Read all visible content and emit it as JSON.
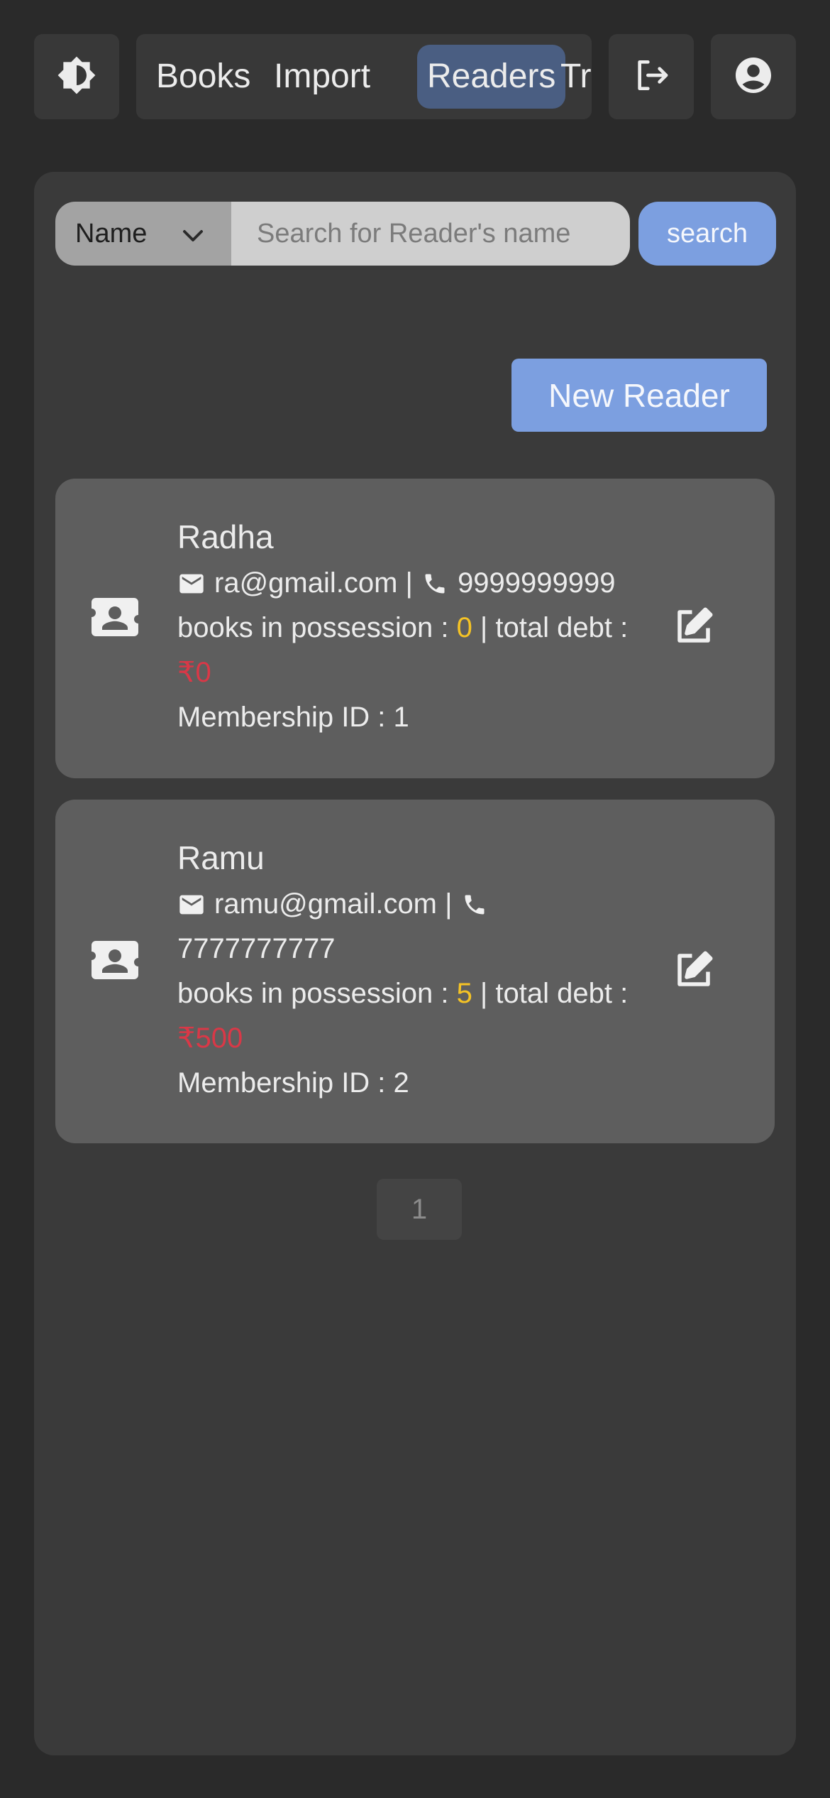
{
  "nav": {
    "tabs": [
      {
        "label": "Books"
      },
      {
        "label": "Import"
      },
      {
        "label": "Readers",
        "active": true
      },
      {
        "label": "Tra"
      }
    ],
    "theme_icon": "brightness-icon",
    "logout_icon": "logout-icon",
    "account_icon": "account-circle-icon"
  },
  "search": {
    "field_selected": "Name",
    "placeholder": "Search for Reader's name",
    "button_label": "search"
  },
  "new_reader_label": "New Reader",
  "readers": [
    {
      "name": "Radha",
      "email": "ra@gmail.com",
      "phone": "9999999999",
      "books_label": "books in possession : ",
      "books_count": "0",
      "debt_label": " | total debt : ",
      "debt": "₹0",
      "membership_label": "Membership ID : ",
      "membership_id": "1"
    },
    {
      "name": "Ramu",
      "email": "ramu@gmail.com",
      "phone": "7777777777",
      "books_label": "books in possession : ",
      "books_count": "5",
      "debt_label": " | total debt : ",
      "debt": "₹500",
      "membership_label": "Membership ID : ",
      "membership_id": "2"
    }
  ],
  "separator": " | ",
  "pagination": {
    "current": "1"
  },
  "colors": {
    "background": "#2a2a2a",
    "panel": "#3a3a3a",
    "card": "#5e5e5e",
    "accent": "#7c9fe0",
    "active_tab": "#4a5e82",
    "count": "#f5c325",
    "debt": "#d93847"
  }
}
